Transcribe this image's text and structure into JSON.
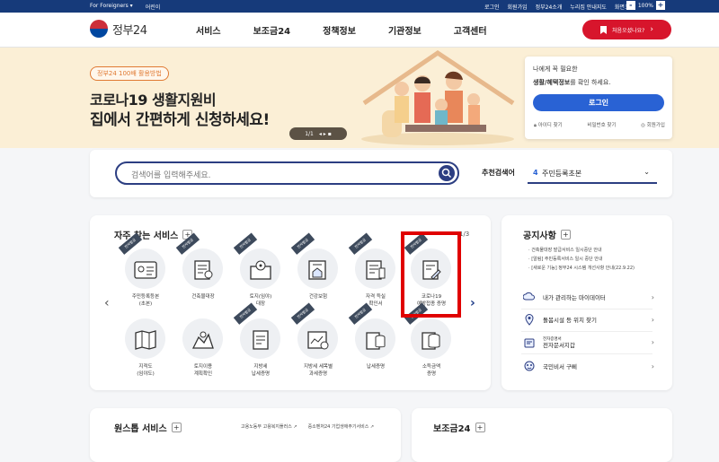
{
  "utilbar": {
    "foreigners": "For Foreigners ▾",
    "kids": "어린이",
    "links": [
      "로그인",
      "회원가입",
      "정부24소개",
      "누리집 안내지도",
      "화면크기"
    ],
    "zoom_minus": "-",
    "zoom_value": "100%",
    "zoom_plus": "+"
  },
  "header": {
    "logo": "정부24",
    "menu": [
      "서비스",
      "보조금24",
      "정책정보",
      "기관정보",
      "고객센터"
    ],
    "first_visit": "처음오셨나요?",
    "first_visit_arrow": "›"
  },
  "hero": {
    "pill": "정부24 100배 활용방법",
    "line1": "코로나19 생활지원비",
    "line2": "집에서 간편하게 신청하세요!",
    "pager": "1/1",
    "pager_controls": "◂ ▸ ▪"
  },
  "login": {
    "line1": "나에게 꼭 필요한",
    "line2_bold": "생활/혜택정보",
    "line2_rest": "를 확인 하세요.",
    "button": "로그인",
    "links": [
      "아이디 찾기",
      "비밀번호 찾기",
      "회원가입"
    ]
  },
  "search": {
    "placeholder": "검색어를 입력해주세요.",
    "rec_label": "추천검색어",
    "rec_num": "4",
    "rec_value": "주민등록초본",
    "rec_chev": "⌄"
  },
  "favorites": {
    "title": "자주 찾는 서비스",
    "plus": "+",
    "page": "1/3",
    "prev": "‹",
    "next": "›",
    "badge": "전자발급",
    "row1": [
      {
        "label1": "주민등록등본",
        "label2": "(초본)",
        "icon": "id-card-icon"
      },
      {
        "label1": "건축물대장",
        "label2": "",
        "icon": "building-doc-icon"
      },
      {
        "label1": "토지(임야)",
        "label2": "대장",
        "icon": "land-map-icon"
      },
      {
        "label1": "건강보험",
        "label2": "",
        "icon": "house-doc-icon"
      },
      {
        "label1": "자격 득실",
        "label2": "확인서",
        "icon": "certificate-icon"
      },
      {
        "label1": "코로나19",
        "label2": "예방접종 증명",
        "icon": "vaccine-doc-icon"
      }
    ],
    "row2": [
      {
        "label1": "지적도",
        "label2": "(임야도)",
        "icon": "cadastral-map-icon"
      },
      {
        "label1": "토지이용",
        "label2": "계획확인",
        "icon": "land-plan-icon"
      },
      {
        "label1": "지방세",
        "label2": "납세증명",
        "icon": "tax-doc-icon"
      },
      {
        "label1": "지방세 세목별",
        "label2": "과세증명",
        "icon": "tax-chart-icon"
      },
      {
        "label1": "납세증명",
        "label2": "",
        "icon": "coins-icon"
      },
      {
        "label1": "소득금액",
        "label2": "증명",
        "icon": "income-coins-icon"
      }
    ]
  },
  "notice": {
    "title": "공지사항",
    "plus": "+",
    "items": [
      "건축물대장 발급서비스 일시중단 안내",
      "[알림] 주민등록서비스 일시 중단 안내",
      "[새로운 기능] 정부24 시스템 개선사항 안내(22.9.22)"
    ],
    "links": [
      {
        "label": "내가 관리하는 마이데이터",
        "icon": "cloud-icon"
      },
      {
        "label": "돌봄시설 등 위치 찾기",
        "icon": "location-pin-icon"
      },
      {
        "label_small": "전자증명서",
        "label": "전자문서지갑",
        "icon": "wallet-icon"
      },
      {
        "label": "국민비서 구삐",
        "icon": "assistant-icon"
      }
    ],
    "chev": "›"
  },
  "onestop": {
    "title": "원스톱 서비스",
    "plus": "+",
    "links": [
      "고용노동부 고용복지플러스 ↗",
      "중소벤처24 기업생애주기서비스 ↗"
    ]
  },
  "bojo": {
    "title": "보조금24",
    "plus": "+"
  },
  "colors": {
    "navy": "#163a7a",
    "accent_red": "#d7152c",
    "login_blue": "#2962d4",
    "hero_bg": "#fbefd6",
    "highlight": "#e00000"
  }
}
